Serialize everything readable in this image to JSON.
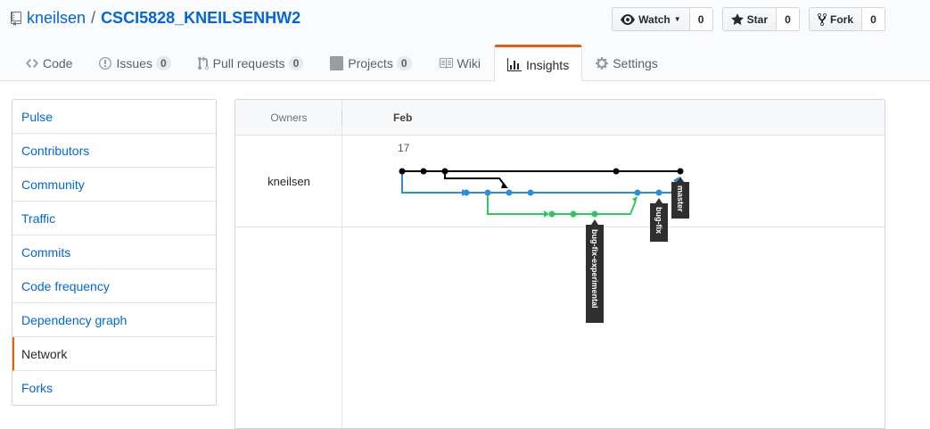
{
  "repo": {
    "owner": "kneilsen",
    "separator": "/",
    "name": "CSCI5828_KNEILSENHW2"
  },
  "actions": [
    {
      "label": "Watch",
      "count": "0",
      "icon": "eye-icon",
      "has_caret": true
    },
    {
      "label": "Star",
      "count": "0",
      "icon": "star-icon"
    },
    {
      "label": "Fork",
      "count": "0",
      "icon": "fork-icon"
    }
  ],
  "tabs": [
    {
      "label": "Code",
      "icon": "code-icon"
    },
    {
      "label": "Issues",
      "counter": "0",
      "icon": "issue-icon"
    },
    {
      "label": "Pull requests",
      "counter": "0",
      "icon": "pull-request-icon"
    },
    {
      "label": "Projects",
      "counter": "0",
      "icon": "project-icon"
    },
    {
      "label": "Wiki",
      "icon": "book-icon"
    },
    {
      "label": "Insights",
      "icon": "graph-icon",
      "selected": true
    },
    {
      "label": "Settings",
      "icon": "gear-icon"
    }
  ],
  "sidebar": {
    "items": [
      {
        "label": "Pulse"
      },
      {
        "label": "Contributors"
      },
      {
        "label": "Community"
      },
      {
        "label": "Traffic"
      },
      {
        "label": "Commits"
      },
      {
        "label": "Code frequency"
      },
      {
        "label": "Dependency graph"
      },
      {
        "label": "Network",
        "selected": true
      },
      {
        "label": "Forks"
      }
    ]
  },
  "network": {
    "owners_header": "Owners",
    "month": "Feb",
    "day": "17",
    "owner": "kneilsen",
    "branches": [
      {
        "name": "master",
        "color": "#000000"
      },
      {
        "name": "bug-fix",
        "color": "#2c8fd6"
      },
      {
        "name": "bug-fix-experimental",
        "color": "#2fc860"
      }
    ]
  },
  "colors": {
    "accent": "#e36209",
    "link": "#0366d6",
    "master": "#000000",
    "bug_fix": "#2c8fd6",
    "experimental": "#2fc860"
  }
}
